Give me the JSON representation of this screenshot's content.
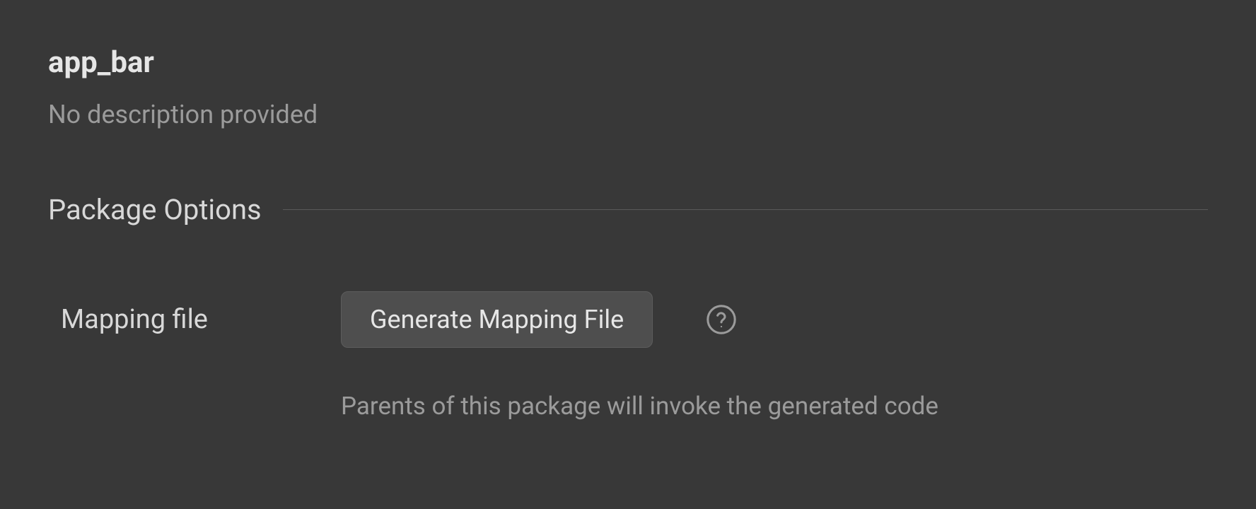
{
  "header": {
    "title": "app_bar",
    "description": "No description provided"
  },
  "section": {
    "title": "Package Options"
  },
  "mapping": {
    "label": "Mapping file",
    "button_label": "Generate Mapping File",
    "hint": "Parents of this package will invoke the generated code"
  }
}
